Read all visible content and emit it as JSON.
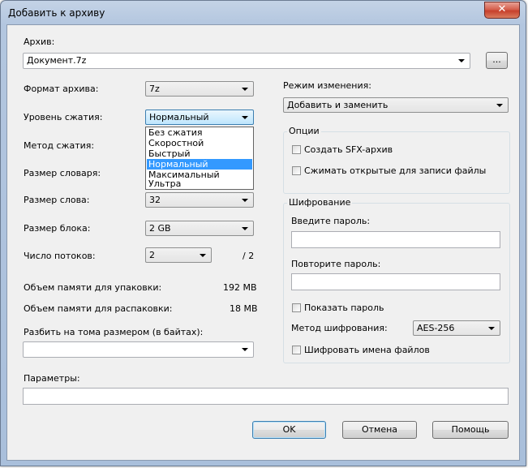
{
  "window": {
    "title": "Добавить к архиву",
    "close_glyph": "✕"
  },
  "archive": {
    "label": "Архив:",
    "value": "Документ.7z",
    "browse_label": "..."
  },
  "left": {
    "format": {
      "label": "Формат архива:",
      "value": "7z"
    },
    "level": {
      "label": "Уровень сжатия:",
      "value": "Нормальный",
      "options": [
        "Без сжатия",
        "Скоростной",
        "Быстрый",
        "Нормальный",
        "Максимальный",
        "Ультра"
      ],
      "selected_index": 3
    },
    "method": {
      "label": "Метод сжатия:"
    },
    "dict": {
      "label": "Размер словаря:"
    },
    "word": {
      "label": "Размер слова:",
      "value": "32"
    },
    "block": {
      "label": "Размер блока:",
      "value": "2 GB"
    },
    "threads": {
      "label": "Число потоков:",
      "value": "2",
      "max": "/ 2"
    },
    "mem_pack": {
      "label": "Объем памяти для упаковки:",
      "value": "192 MB"
    },
    "mem_unpack": {
      "label": "Объем памяти для распаковки:",
      "value": "18 MB"
    },
    "split": {
      "label": "Разбить на тома размером (в байтах):",
      "value": ""
    }
  },
  "right": {
    "update_mode": {
      "label": "Режим изменения:",
      "value": "Добавить и заменить"
    },
    "options": {
      "title": "Опции",
      "sfx": "Создать SFX-архив",
      "shared": "Сжимать открытые для записи файлы"
    },
    "encryption": {
      "title": "Шифрование",
      "enter_pw": "Введите пароль:",
      "repeat_pw": "Повторите пароль:",
      "show_pw": "Показать пароль",
      "method_label": "Метод шифрования:",
      "method_value": "AES-256",
      "encrypt_names": "Шифровать имена файлов"
    }
  },
  "params": {
    "label": "Параметры:",
    "value": ""
  },
  "buttons": {
    "ok": "OK",
    "cancel": "Отмена",
    "help": "Помощь"
  }
}
